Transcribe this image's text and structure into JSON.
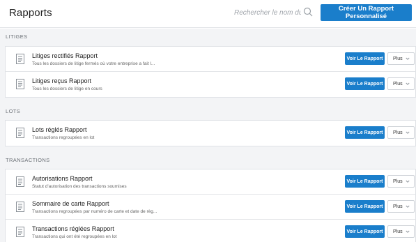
{
  "header": {
    "title": "Rapports",
    "search_placeholder": "Rechercher le nom du ra",
    "create_label": "Créer Un Rapport Personnalisé"
  },
  "sections": [
    {
      "title": "LITIGES",
      "rows": [
        {
          "title": "Litiges rectifiés Rapport",
          "desc": "Tous les dossiers de litige fermés où votre entreprise a fait l...",
          "view": "Voir Le Rapport",
          "more": "Plus"
        },
        {
          "title": "Litiges reçus Rapport",
          "desc": "Tous les dossiers de litige en cours",
          "view": "Voir Le Rapport",
          "more": "Plus"
        }
      ]
    },
    {
      "title": "LOTS",
      "rows": [
        {
          "title": "Lots réglés Rapport",
          "desc": "Transactions regroupées en lot",
          "view": "Voir Le Rapport",
          "more": "Plus"
        }
      ]
    },
    {
      "title": "TRANSACTIONS",
      "rows": [
        {
          "title": "Autorisations Rapport",
          "desc": "Statut d'autorisation des transactions soumises",
          "view": "Voir Le Rapport",
          "more": "Plus"
        },
        {
          "title": "Sommaire de carte Rapport",
          "desc": "Transactions regroupées par numéro de carte et date de règ...",
          "view": "Voir Le Rapport",
          "more": "Plus"
        },
        {
          "title": "Transactions réglées Rapport",
          "desc": "Transactions qui ont été regroupées en lot",
          "view": "Voir Le Rapport",
          "more": "Plus"
        }
      ]
    }
  ],
  "colors": {
    "accent": "#1a7ecb",
    "background": "#f3f4f6"
  },
  "icons": {
    "search": "search-icon",
    "document": "document-icon",
    "caret": "chevron-down-icon"
  }
}
